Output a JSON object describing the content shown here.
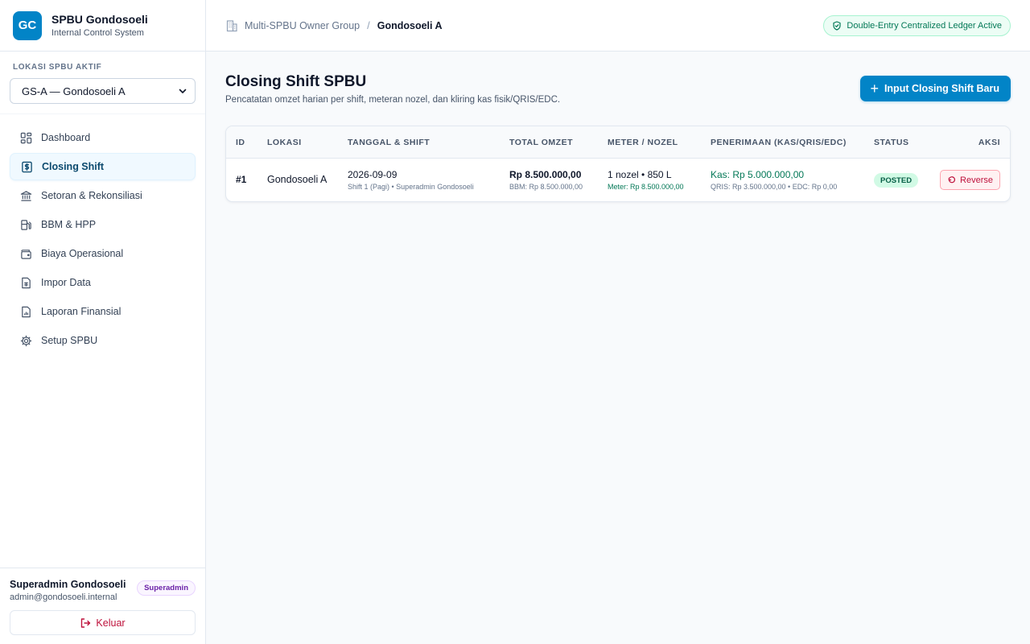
{
  "brand": {
    "logo": "GC",
    "title": "SPBU Gondosoeli",
    "subtitle": "Internal Control System"
  },
  "location": {
    "label": "LOKASI SPBU AKTIF",
    "selected": "GS-A — Gondosoeli A"
  },
  "nav": [
    {
      "label": "Dashboard",
      "icon": "dashboard-icon"
    },
    {
      "label": "Closing Shift",
      "icon": "dollar-receipt-icon",
      "active": true
    },
    {
      "label": "Setoran & Rekonsiliasi",
      "icon": "bank-icon"
    },
    {
      "label": "BBM & HPP",
      "icon": "fuel-pump-icon"
    },
    {
      "label": "Biaya Operasional",
      "icon": "wallet-icon"
    },
    {
      "label": "Impor Data",
      "icon": "spreadsheet-icon"
    },
    {
      "label": "Laporan Finansial",
      "icon": "report-icon"
    },
    {
      "label": "Setup SPBU",
      "icon": "gear-icon"
    }
  ],
  "user": {
    "name": "Superadmin Gondosoeli",
    "email": "admin@gondosoeli.internal",
    "role": "Superadmin",
    "logout_label": "Keluar"
  },
  "breadcrumb": {
    "group": "Multi-SPBU Owner Group",
    "current": "Gondosoeli A"
  },
  "ledger_badge": "Double-Entry Centralized Ledger Active",
  "page": {
    "title": "Closing Shift SPBU",
    "subtitle": "Pencatatan omzet harian per shift, meteran nozel, dan kliring kas fisik/QRIS/EDC.",
    "primary_button": "Input Closing Shift Baru"
  },
  "table": {
    "headers": [
      "ID",
      "LOKASI",
      "TANGGAL & SHIFT",
      "TOTAL OMZET",
      "METER / NOZEL",
      "PENERIMAAN (KAS/QRIS/EDC)",
      "STATUS",
      "AKSI"
    ],
    "rows": [
      {
        "id": "#1",
        "location": "Gondosoeli A",
        "date": "2026-09-09",
        "shift_detail": "Shift 1 (Pagi) • Superadmin Gondosoeli",
        "total": "Rp 8.500.000,00",
        "total_detail": "BBM: Rp 8.500.000,00",
        "meter": "1 nozel • 850 L",
        "meter_detail": "Meter: Rp 8.500.000,00",
        "cash": "Kas: Rp 5.000.000,00",
        "cash_detail": "QRIS: Rp 3.500.000,00 • EDC: Rp 0,00",
        "status": "POSTED",
        "action": "Reverse"
      }
    ]
  },
  "colors": {
    "accent": "#0284c7",
    "success": "#047857",
    "danger": "#be123c",
    "role": "#6b21a8"
  }
}
